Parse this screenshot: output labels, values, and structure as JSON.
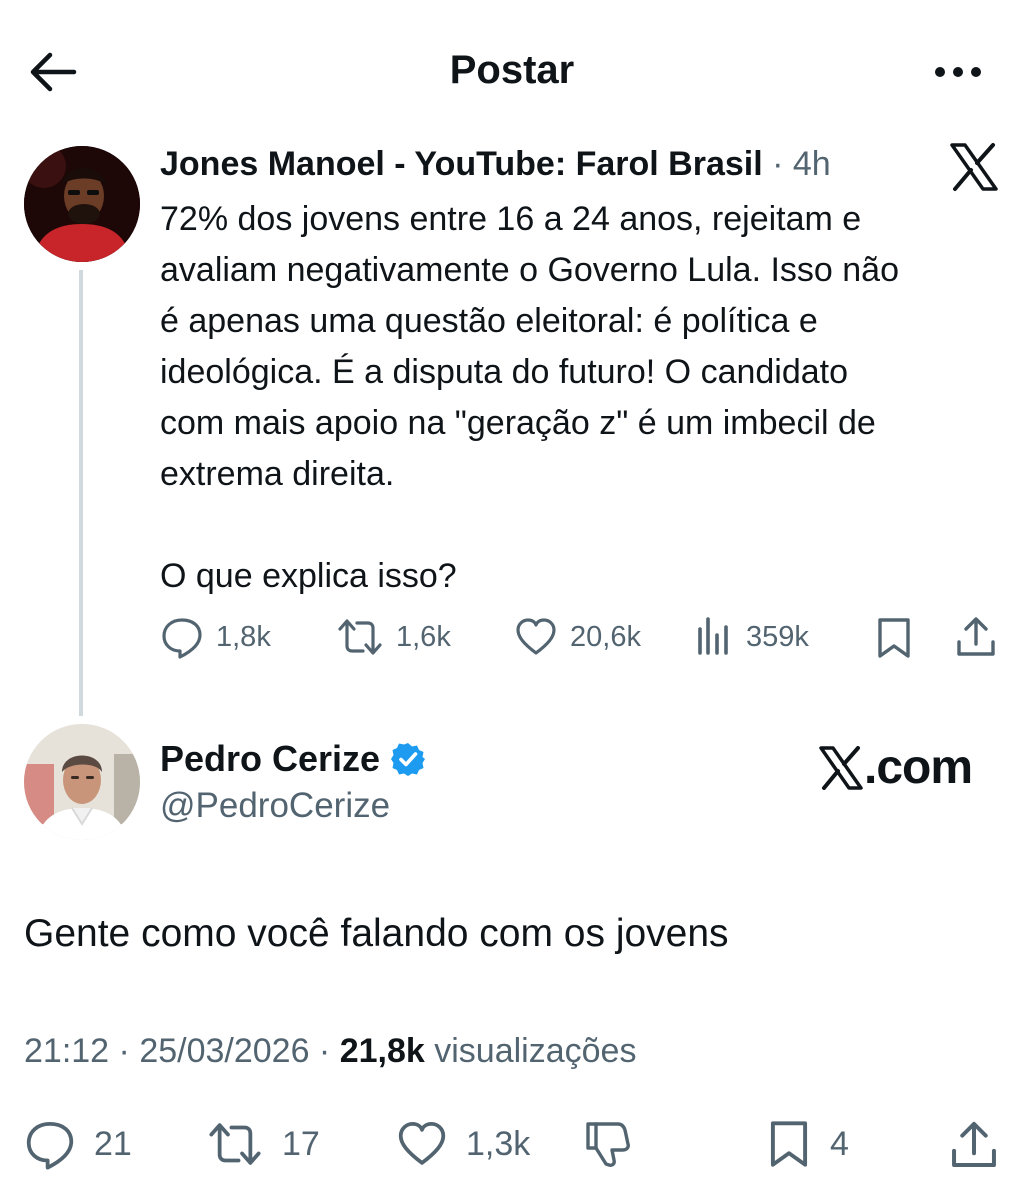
{
  "header": {
    "title": "Postar"
  },
  "quoted_post": {
    "author_name": "Jones Manoel - YouTube: Farol Brasil",
    "separator": "·",
    "time": "4h",
    "text": "72% dos jovens entre 16 a 24 anos, rejeitam e\navaliam negativamente o Governo Lula. Isso não\né apenas uma questão eleitoral: é política e\nideológica. É a disputa do futuro! O candidato\ncom mais apoio na \"geração z\" é um imbecil de\nextrema direita.\n\nO que explica isso?",
    "actions": {
      "replies": "1,8k",
      "reposts": "1,6k",
      "likes": "20,6k",
      "views": "359k"
    }
  },
  "reply_post": {
    "author_name": "Pedro Cerize",
    "handle": "@PedroCerize",
    "watermark": ".com",
    "text": "Gente como você falando com os jovens",
    "meta": {
      "time": "21:12",
      "dot1": " · ",
      "date": "25/03/2026",
      "dot2": " · ",
      "views_count": "21,8k",
      "views_label": " visualizações"
    },
    "actions": {
      "replies": "21",
      "reposts": "17",
      "likes": "1,3k",
      "bookmarks": "4"
    }
  },
  "colors": {
    "text": "#0f1419",
    "secondary": "#536471",
    "verified": "#1d9bf0",
    "thread_line": "#cfd9de"
  }
}
